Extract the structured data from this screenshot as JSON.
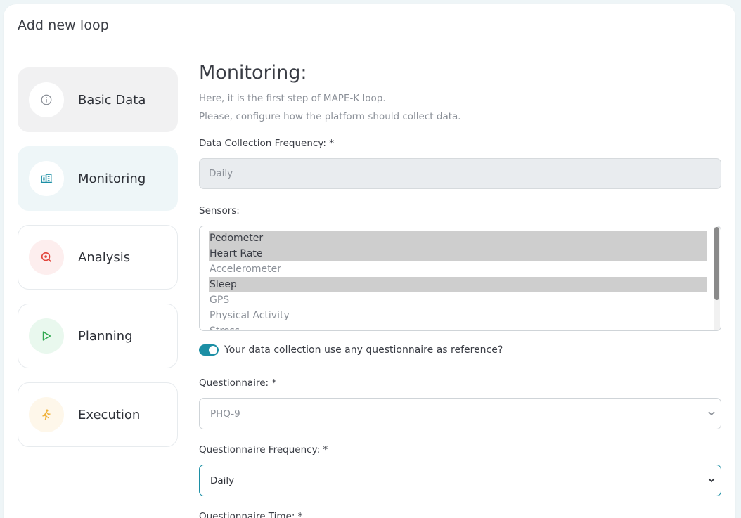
{
  "header": {
    "title": "Add new loop"
  },
  "steps": [
    {
      "label": "Basic Data",
      "icon": "info-icon"
    },
    {
      "label": "Monitoring",
      "icon": "building-chart-icon"
    },
    {
      "label": "Analysis",
      "icon": "search-target-icon"
    },
    {
      "label": "Planning",
      "icon": "play-icon"
    },
    {
      "label": "Execution",
      "icon": "running-person-icon"
    }
  ],
  "colors": {
    "accent": "#1c8fa5",
    "analysis": "#e2453c",
    "planning": "#2fa84f",
    "execution": "#f0b23a"
  },
  "main": {
    "title": "Monitoring:",
    "desc1": "Here, it is the first step of MAPE-K loop.",
    "desc2": "Please, configure how the platform should collect data.",
    "frequency_label": "Data Collection Frequency: *",
    "frequency_value": "Daily",
    "sensors_label": "Sensors:",
    "sensors": [
      {
        "name": "Pedometer",
        "selected": true
      },
      {
        "name": "Heart Rate",
        "selected": true
      },
      {
        "name": "Accelerometer",
        "selected": false
      },
      {
        "name": "Sleep",
        "selected": true
      },
      {
        "name": "GPS",
        "selected": false
      },
      {
        "name": "Physical Activity",
        "selected": false
      },
      {
        "name": "Stress",
        "selected": false
      }
    ],
    "questionnaire_toggle_label": "Your data collection use any questionnaire as reference?",
    "questionnaire_toggle_on": true,
    "questionnaire_label": "Questionnaire: *",
    "questionnaire_value": "PHQ-9",
    "questionnaire_frequency_label": "Questionnaire Frequency: *",
    "questionnaire_frequency_value": "Daily",
    "questionnaire_time_label": "Questionnaire Time: *"
  }
}
